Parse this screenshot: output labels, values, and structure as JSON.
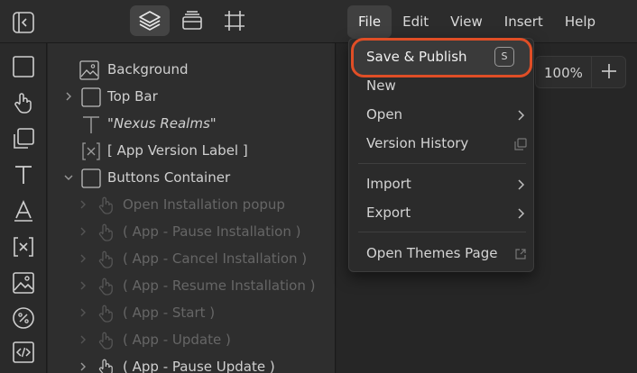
{
  "menubar": [
    "File",
    "Edit",
    "View",
    "Insert",
    "Help"
  ],
  "file_menu": {
    "save_publish": "Save & Publish",
    "save_shortcut": "S",
    "new": "New",
    "open": "Open",
    "version_history": "Version History",
    "import": "Import",
    "export": "Export",
    "open_themes": "Open Themes Page"
  },
  "zoom": {
    "value": "100%"
  },
  "layers": [
    {
      "label": "Background",
      "icon": "image-icon"
    },
    {
      "label": "Top Bar",
      "icon": "frame-icon"
    },
    {
      "label": "\"Nexus Realms\"",
      "icon": "text-icon"
    },
    {
      "label": "[ App Version Label ]",
      "icon": "variable-icon"
    },
    {
      "label": "Buttons Container",
      "icon": "frame-icon"
    },
    {
      "label": "Open Installation popup",
      "icon": "hand-pointer-icon"
    },
    {
      "label": "( App - Pause Installation )",
      "icon": "hand-pointer-icon"
    },
    {
      "label": "( App - Cancel Installation )",
      "icon": "hand-pointer-icon"
    },
    {
      "label": "( App - Resume Installation )",
      "icon": "hand-pointer-icon"
    },
    {
      "label": "( App - Start )",
      "icon": "hand-pointer-icon"
    },
    {
      "label": "( App - Update )",
      "icon": "hand-pointer-icon"
    },
    {
      "label": "( App - Pause Update )",
      "icon": "hand-pointer-icon"
    }
  ],
  "colors": {
    "accent": "#e04e26",
    "panel": "#2e2e2e",
    "topbar": "#2c2c2c"
  }
}
